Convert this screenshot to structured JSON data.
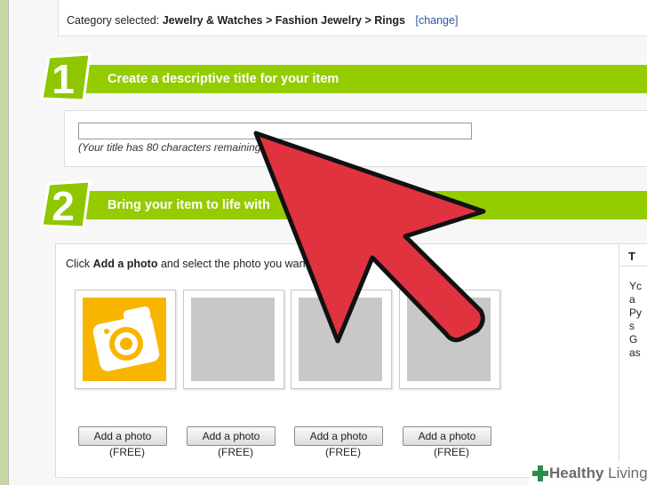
{
  "category": {
    "prefix": "Category selected:",
    "path": "Jewelry & Watches > Fashion Jewelry > Rings",
    "change_link": "[change]"
  },
  "step1": {
    "number": "1",
    "title": "Create a descriptive title for your item"
  },
  "title_field": {
    "value": "",
    "hint": "(Your title has 80 characters remaining"
  },
  "step2": {
    "number": "2",
    "title": "Bring your item to life with"
  },
  "photos": {
    "instruction_pre": "Click",
    "instruction_bold": "Add a photo",
    "instruction_post": "and select the photo you wan",
    "slots": [
      {
        "button": "Add a photo",
        "price": "(FREE)",
        "icon": "camera-icon"
      },
      {
        "button": "Add a photo",
        "price": "(FREE)"
      },
      {
        "button": "Add a photo",
        "price": "(FREE)"
      },
      {
        "button": "Add a photo",
        "price": "(FREE)"
      }
    ]
  },
  "side_panel": {
    "title": "T",
    "text": "YcaPysGas"
  },
  "watermark": {
    "brand": "Healthy",
    "sub": "Living"
  },
  "colors": {
    "accent_green": "#95cc00",
    "arrow_red": "#e0323f",
    "camera_yellow": "#f7b500"
  }
}
